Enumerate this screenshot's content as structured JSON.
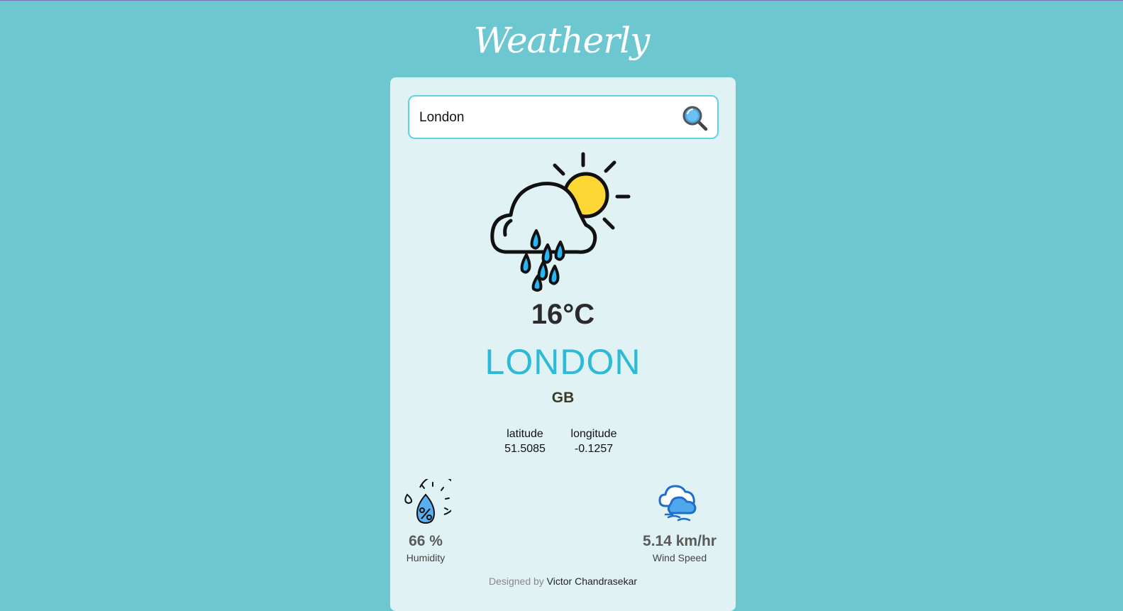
{
  "app": {
    "logo": "Weatherly"
  },
  "search": {
    "value": "London",
    "placeholder": ""
  },
  "weather": {
    "icon": "cloud-rain-sun-icon",
    "temperature": "16°C",
    "city": "LONDON",
    "country": "GB"
  },
  "coordinates": {
    "latitude_label": "latitude",
    "latitude_value": "51.5085",
    "longitude_label": "longitude",
    "longitude_value": "-0.1257"
  },
  "stats": {
    "humidity": {
      "value": "66 %",
      "label": "Humidity",
      "icon": "humidity-gauge-icon"
    },
    "wind": {
      "value": "5.14 km/hr",
      "label": "Wind Speed",
      "icon": "wind-cloud-icon"
    }
  },
  "footer": {
    "prefix": "Designed by",
    "author": "Victor Chandrasekar"
  },
  "colors": {
    "background": "#6dc7d1",
    "card": "#e0f2f3",
    "accent": "#2cbad9",
    "sun": "#fdd835",
    "raindrop": "#29b6f6"
  }
}
